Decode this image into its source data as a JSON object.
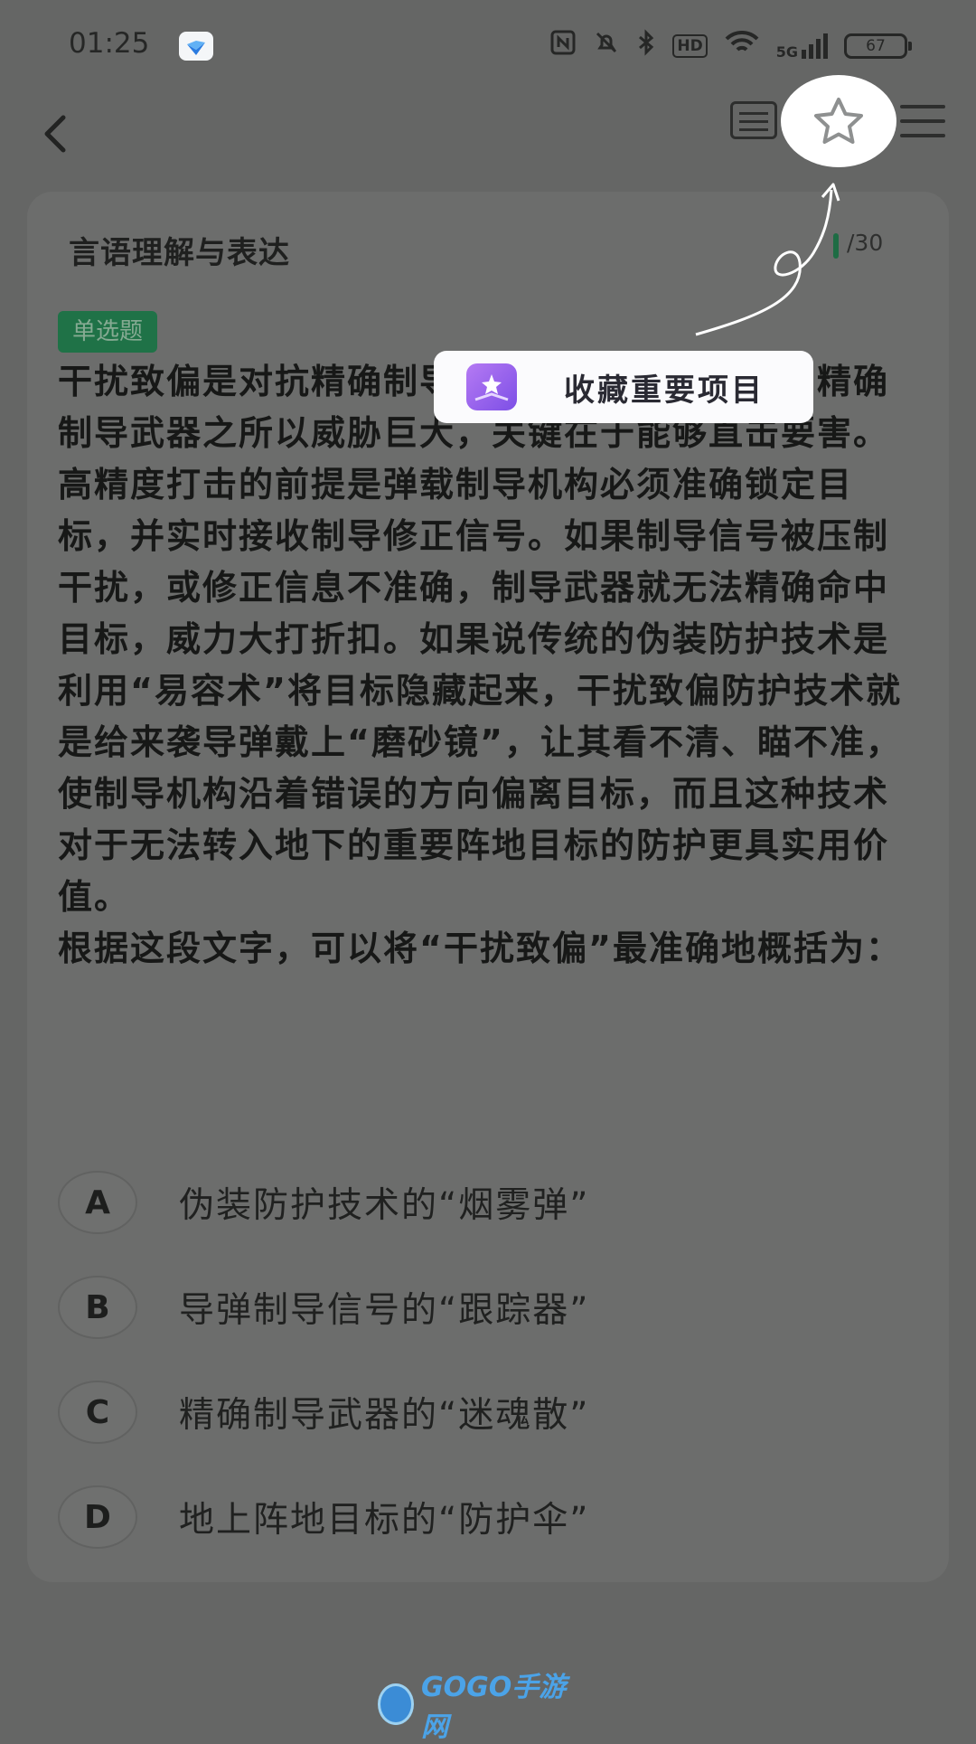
{
  "status": {
    "time": "01:25",
    "network": "5G",
    "hd": "HD",
    "battery": "67"
  },
  "header": {
    "section_title": "言语理解与表达",
    "progress": "/30"
  },
  "question": {
    "type_tag": "单选题",
    "text": "干扰致偏是对抗精确制导武器的一种有效手段。精确制导武器之所以威胁巨大，关键在于能够直击要害。高精度打击的前提是弹载制导机构必须准确锁定目标，并实时接收制导修正信号。如果制导信号被压制干扰，或修正信息不准确，制导武器就无法精确命中目标，威力大打折扣。如果说传统的伪装防护技术是利用“易容术”将目标隐藏起来，干扰致偏防护技术就是给来袭导弹戴上“磨砂镜”，让其看不清、瞄不准，使制导机构沿着错误的方向偏离目标，而且这种技术对于无法转入地下的重要阵地目标的防护更具实用价值。\n根据这段文字，可以将“干扰致偏”最准确地概括为：",
    "options": [
      {
        "letter": "A",
        "text": "伪装防护技术的“烟雾弹”"
      },
      {
        "letter": "B",
        "text": "导弹制导信号的“跟踪器”"
      },
      {
        "letter": "C",
        "text": "精确制导武器的“迷魂散”"
      },
      {
        "letter": "D",
        "text": "地上阵地目标的“防护伞”"
      }
    ]
  },
  "tooltip": {
    "text": "收藏重要项目"
  },
  "watermark": {
    "text": "GOGO手游网"
  },
  "colors": {
    "overlay": "#656665",
    "tag_bg": "#1f7247",
    "tooltip_icon": "#9a63ee"
  }
}
